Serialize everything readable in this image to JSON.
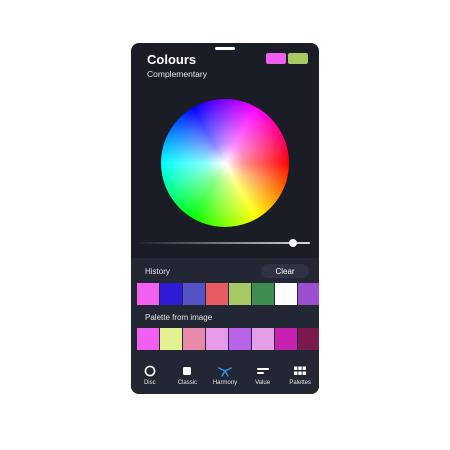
{
  "header": {
    "title": "Colours",
    "subtitle": "Complementary",
    "current_colors": [
      "#f05ff0",
      "#a6c964"
    ]
  },
  "wheel": {
    "brightness_level": 0.9
  },
  "history": {
    "label": "History",
    "clear_label": "Clear",
    "colors": [
      "#f05ff0",
      "#2d1bd6",
      "#5453c8",
      "#e85b64",
      "#a6c964",
      "#3f8e4f",
      "#ffffff",
      "#9b4fd0"
    ]
  },
  "palette": {
    "label": "Palette from image",
    "colors": [
      "#f05ff0",
      "#e2f08f",
      "#e789a8",
      "#e79ae8",
      "#b864e8",
      "#e59ee8",
      "#c721b0",
      "#7a1a4d"
    ]
  },
  "tabs": [
    {
      "label": "Disc",
      "icon": "disc-icon"
    },
    {
      "label": "Classic",
      "icon": "square-icon"
    },
    {
      "label": "Harmony",
      "icon": "harmony-icon"
    },
    {
      "label": "Value",
      "icon": "value-icon"
    },
    {
      "label": "Palettes",
      "icon": "grid-icon"
    }
  ],
  "active_tab": "Harmony",
  "colors": {
    "panel": "#1b1d26",
    "lower_panel": "#232633",
    "accent": "#3d8ef0"
  }
}
